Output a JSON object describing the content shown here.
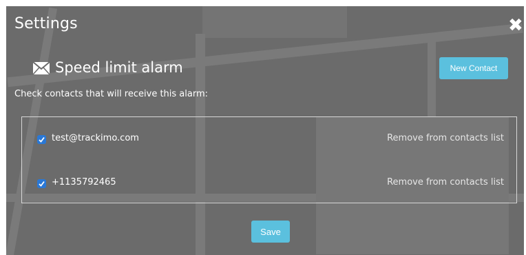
{
  "header": {
    "title": "Settings",
    "close_icon": "close-icon"
  },
  "alarm": {
    "title": "Speed limit alarm",
    "icon": "envelope-icon",
    "instruction": "Check contacts that will receive this alarm:",
    "new_contact_label": "New Contact"
  },
  "contacts": [
    {
      "value": "test@trackimo.com",
      "checked": true,
      "remove_label": "Remove from contacts list"
    },
    {
      "value": "+1135792465",
      "checked": true,
      "remove_label": "Remove from contacts list"
    }
  ],
  "footer": {
    "save_label": "Save"
  },
  "colors": {
    "accent": "#5bc0de",
    "checkbox": "#2a78d6",
    "overlay": "#6b6b6b"
  }
}
